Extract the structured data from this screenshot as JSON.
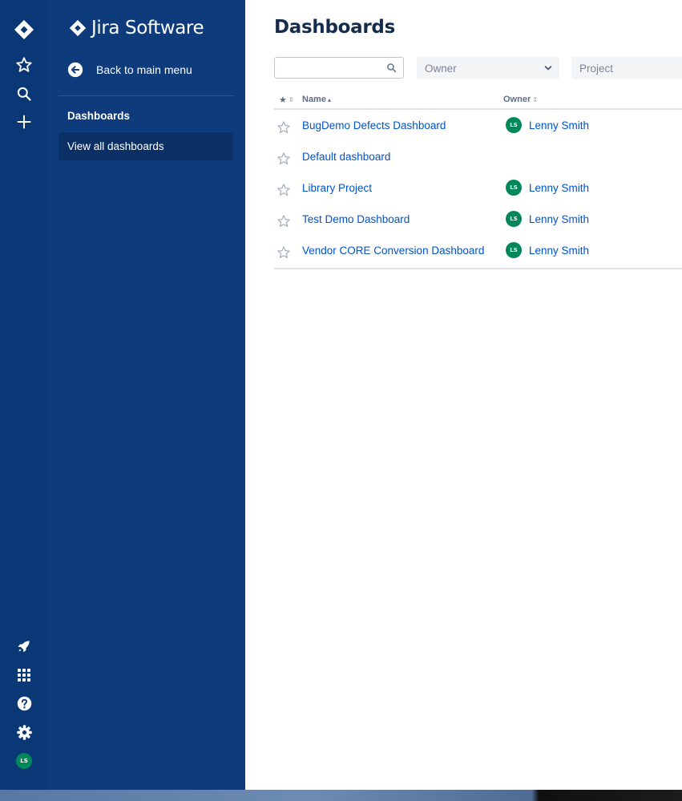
{
  "global_nav": {
    "icons": [
      "jira-logo-icon",
      "star-icon",
      "search-icon",
      "create-plus-icon",
      "rocket-icon",
      "app-switcher-icon",
      "help-icon",
      "settings-icon"
    ],
    "user_initials": "LS",
    "accent_color": "#0a3876"
  },
  "sidebar": {
    "product_name": "Jira Software",
    "back_label": "Back to main menu",
    "section_heading": "Dashboards",
    "items": [
      {
        "label": "View all dashboards",
        "selected": true
      }
    ]
  },
  "main": {
    "title": "Dashboards",
    "search": {
      "value": "",
      "placeholder": ""
    },
    "owner_filter": {
      "placeholder": "Owner"
    },
    "project_filter": {
      "placeholder": "Project"
    },
    "table": {
      "columns": {
        "star": "★",
        "name": "Name",
        "owner": "Owner"
      },
      "rows": [
        {
          "name": "BugDemo Defects Dashboard",
          "owner": "Lenny Smith",
          "owner_initials": "LS"
        },
        {
          "name": "Default dashboard",
          "owner": "",
          "owner_initials": ""
        },
        {
          "name": "Library Project",
          "owner": "Lenny Smith",
          "owner_initials": "LS"
        },
        {
          "name": "Test Demo Dashboard",
          "owner": "Lenny Smith",
          "owner_initials": "LS"
        },
        {
          "name": "Vendor CORE Conversion Dashboard",
          "owner": "Lenny Smith",
          "owner_initials": "LS"
        }
      ]
    }
  }
}
